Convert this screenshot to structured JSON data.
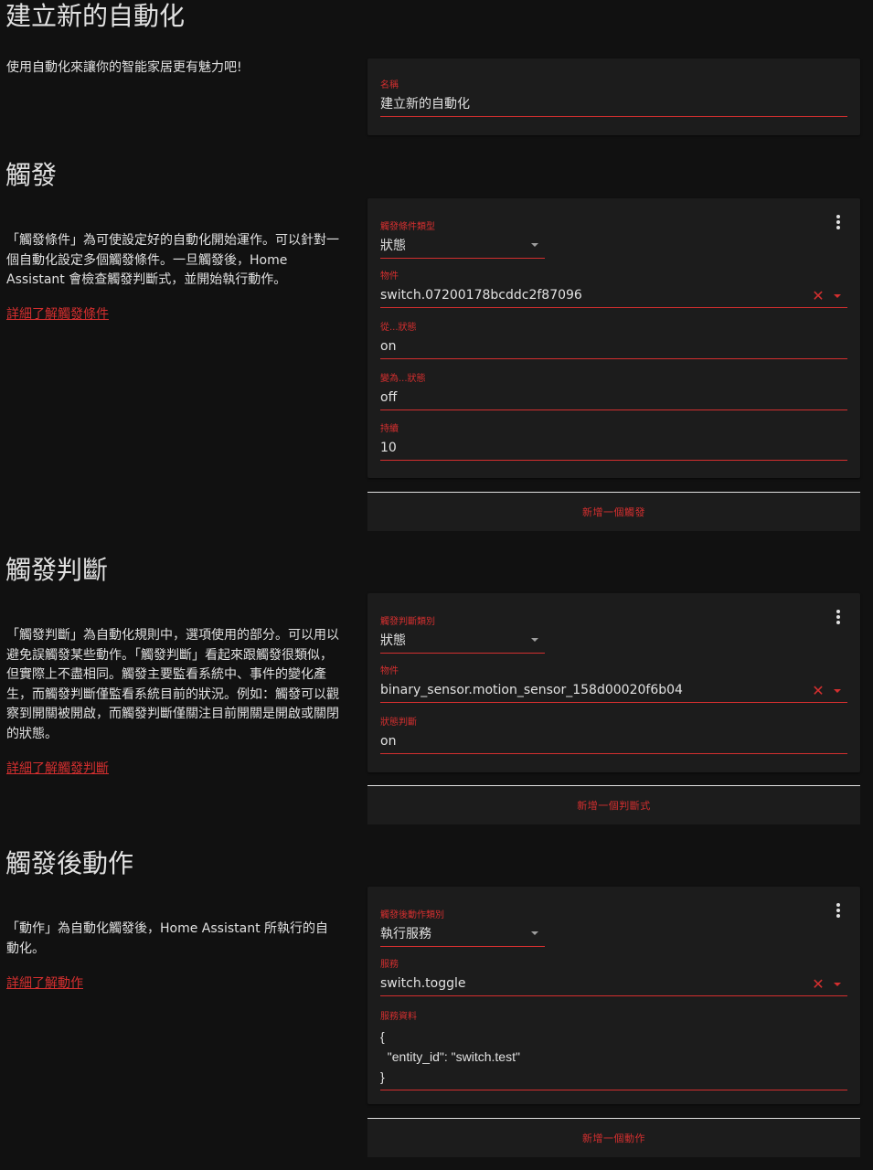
{
  "page": {
    "title": "建立新的自動化",
    "intro": "使用自動化來讓你的智能家居更有魅力吧!"
  },
  "name_card": {
    "label": "名稱",
    "value": "建立新的自動化"
  },
  "triggers": {
    "heading": "觸發",
    "description": "「觸發條件」為可使設定好的自動化開始運作。可以針對一個自動化設定多個觸發條件。一旦觸發後，Home Assistant 會檢查觸發判斷式，並開始執行動作。",
    "learn_more": "詳細了解觸發條件",
    "type_label": "觸發條件類型",
    "type_value": "狀態",
    "entity_label": "物件",
    "entity_value": "switch.07200178bcddc2f87096",
    "from_label": "從...狀態",
    "from_value": "on",
    "to_label": "變為...狀態",
    "to_value": "off",
    "for_label": "持續",
    "for_value": "10",
    "add_button": "新增一個觸發"
  },
  "conditions": {
    "heading": "觸發判斷",
    "description": "「觸發判斷」為自動化規則中，選項使用的部分。可以用以避免誤觸發某些動作。「觸發判斷」看起來跟觸發很類似，但實際上不盡相同。觸發主要監看系統中、事件的變化產生，而觸發判斷僅監看系統目前的狀況。例如：觸發可以觀察到開關被開啟，而觸發判斷僅關注目前開關是開啟或關閉的狀態。",
    "learn_more": "詳細了解觸發判斷",
    "type_label": "觸發判斷類別",
    "type_value": "狀態",
    "entity_label": "物件",
    "entity_value": "binary_sensor.motion_sensor_158d00020f6b04",
    "state_label": "狀態判斷",
    "state_value": "on",
    "add_button": "新增一個判斷式"
  },
  "actions": {
    "heading": "觸發後動作",
    "description": "「動作」為自動化觸發後，Home Assistant 所執行的自動化。",
    "learn_more": "詳細了解動作",
    "type_label": "觸發後動作類別",
    "type_value": "執行服務",
    "service_label": "服務",
    "service_value": "switch.toggle",
    "data_label": "服務資料",
    "data_line1": "{",
    "data_line2": "  \"entity_id\": \"switch.test\"",
    "data_line3": "}",
    "add_button": "新增一個動作"
  },
  "icons": {
    "menu": "more-vert-icon",
    "clear": "close-icon",
    "dropdown": "chevron-down-icon"
  },
  "colors": {
    "background": "#111111",
    "card": "#1c1c1c",
    "accent": "#d32f2f",
    "text": "#e1e1e1"
  }
}
